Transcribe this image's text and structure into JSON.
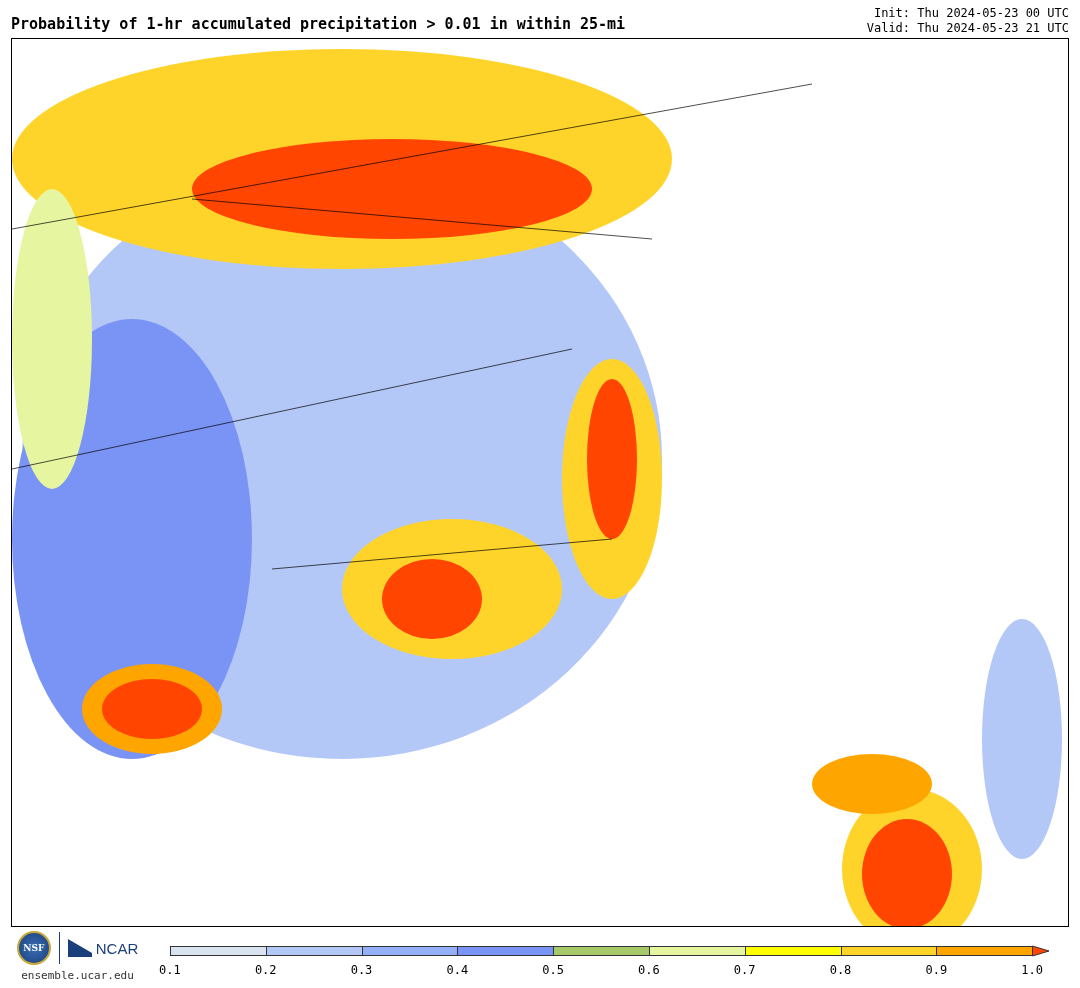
{
  "title": "Probability of 1-hr accumulated precipitation > 0.01 in within 25-mi",
  "init": "Init: Thu 2024-05-23 00 UTC",
  "valid": "Valid: Thu 2024-05-23 21 UTC",
  "logos": {
    "nsf": "NSF",
    "ncar": "NCAR",
    "site": "ensemble.ucar.edu"
  },
  "colorbar": {
    "bins": [
      {
        "color": "#d9e3ef"
      },
      {
        "color": "#b4c8f8"
      },
      {
        "color": "#93b0f8"
      },
      {
        "color": "#7a94f5"
      },
      {
        "color": "#a6c96a"
      },
      {
        "color": "#e6f5a0"
      },
      {
        "color": "#ffff00"
      },
      {
        "color": "#ffd42a"
      },
      {
        "color": "#ffa500"
      },
      {
        "color": "#ff4500",
        "kind": "arrow"
      }
    ],
    "ticks": [
      "0.1",
      "0.2",
      "0.3",
      "0.4",
      "0.5",
      "0.6",
      "0.7",
      "0.8",
      "0.9",
      "1.0"
    ]
  }
}
